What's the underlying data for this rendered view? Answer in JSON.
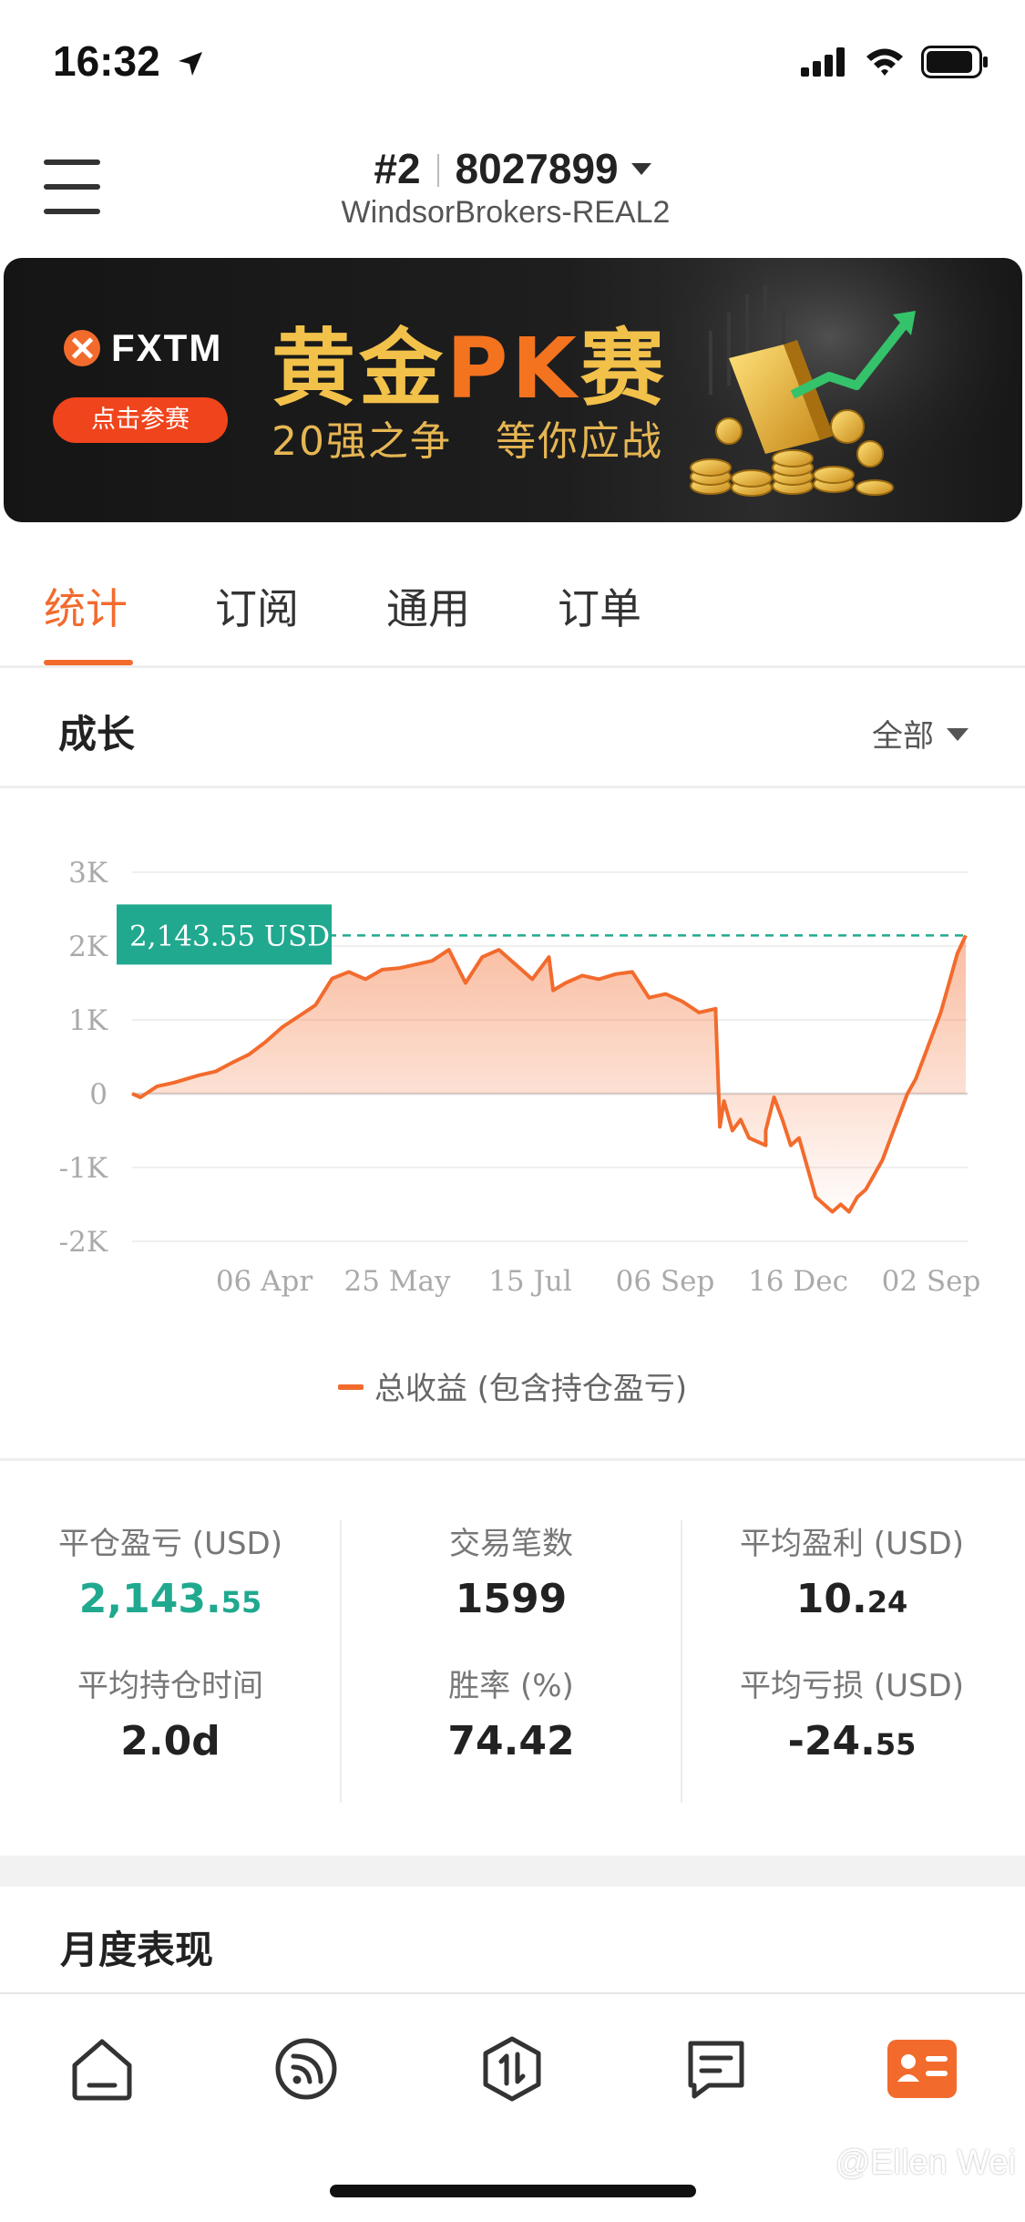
{
  "status_bar": {
    "time": "16:32",
    "icons": [
      "location-arrow-icon",
      "signal-icon",
      "wifi-icon",
      "battery-icon"
    ]
  },
  "header": {
    "account_rank": "#2",
    "account_number": "8027899",
    "broker": "WindsorBrokers-REAL2"
  },
  "banner": {
    "brand": "FXTM",
    "button": "点击参赛",
    "title_pre": "黄金",
    "title_pk": "PK",
    "title_post": "赛",
    "subtitle": "20强之争   等你应战"
  },
  "tabs": [
    {
      "label": "统计",
      "active": true
    },
    {
      "label": "订阅",
      "active": false
    },
    {
      "label": "通用",
      "active": false
    },
    {
      "label": "订单",
      "active": false
    }
  ],
  "growth": {
    "title": "成长",
    "range": "全部"
  },
  "chart_data": {
    "type": "area",
    "ylim": [
      -2000,
      3000
    ],
    "y_ticks": [
      "3K",
      "2K",
      "1K",
      "0",
      "-1K",
      "-2K"
    ],
    "x_ticks": [
      "06 Apr",
      "25 May",
      "15 Jul",
      "06 Sep",
      "16 Dec",
      "02 Sep"
    ],
    "current_label": "2,143.55 USD",
    "current_value": 2143.55,
    "series": [
      {
        "name": "总收益 (包含持仓盈亏)",
        "color": "#f26b2d",
        "x": [
          0,
          0.01,
          0.03,
          0.05,
          0.08,
          0.1,
          0.12,
          0.14,
          0.16,
          0.18,
          0.2,
          0.22,
          0.24,
          0.26,
          0.28,
          0.3,
          0.32,
          0.34,
          0.36,
          0.38,
          0.4,
          0.42,
          0.44,
          0.46,
          0.48,
          0.5,
          0.505,
          0.52,
          0.54,
          0.56,
          0.58,
          0.6,
          0.62,
          0.64,
          0.66,
          0.68,
          0.7,
          0.7,
          0.705,
          0.71,
          0.72,
          0.73,
          0.74,
          0.76,
          0.76,
          0.77,
          0.78,
          0.79,
          0.8,
          0.81,
          0.82,
          0.83,
          0.84,
          0.85,
          0.86,
          0.87,
          0.88,
          0.89,
          0.9,
          0.91,
          0.92,
          0.93,
          0.94,
          0.95,
          0.96,
          0.97,
          0.98,
          0.99,
          1.0
        ],
        "values": [
          0,
          -50,
          100,
          150,
          250,
          300,
          420,
          530,
          700,
          900,
          1050,
          1200,
          1560,
          1650,
          1550,
          1680,
          1700,
          1750,
          1800,
          1950,
          1500,
          1850,
          1950,
          1750,
          1550,
          1850,
          1400,
          1500,
          1600,
          1550,
          1620,
          1650,
          1300,
          1350,
          1250,
          1100,
          1150,
          1100,
          -450,
          -100,
          -500,
          -350,
          -600,
          -700,
          -500,
          -50,
          -350,
          -700,
          -600,
          -1000,
          -1400,
          -1500,
          -1600,
          -1500,
          -1600,
          -1400,
          -1300,
          -1100,
          -900,
          -600,
          -300,
          0,
          200,
          500,
          800,
          1100,
          1500,
          1900,
          2143.55
        ]
      }
    ]
  },
  "stats": [
    {
      "label": "平仓盈亏 (USD)",
      "value_main": "2,143.",
      "value_small": "55",
      "highlight": true
    },
    {
      "label": "交易笔数",
      "value_main": "1599",
      "value_small": ""
    },
    {
      "label": "平均盈利 (USD)",
      "value_main": "10.",
      "value_small": "24"
    },
    {
      "label": "平均持仓时间",
      "value_main": "2.0d",
      "value_small": ""
    },
    {
      "label": "胜率 (%)",
      "value_main": "74.42",
      "value_small": ""
    },
    {
      "label": "平均亏损 (USD)",
      "value_main": "-24.",
      "value_small": "55"
    }
  ],
  "monthly": {
    "title": "月度表现"
  },
  "bottom_nav": [
    "home-icon",
    "feed-icon",
    "trade-icon",
    "message-icon",
    "profile-card-icon"
  ],
  "watermark": "@Ellen Wei",
  "colors": {
    "accent": "#f26b2d",
    "positive": "#20a98f"
  }
}
